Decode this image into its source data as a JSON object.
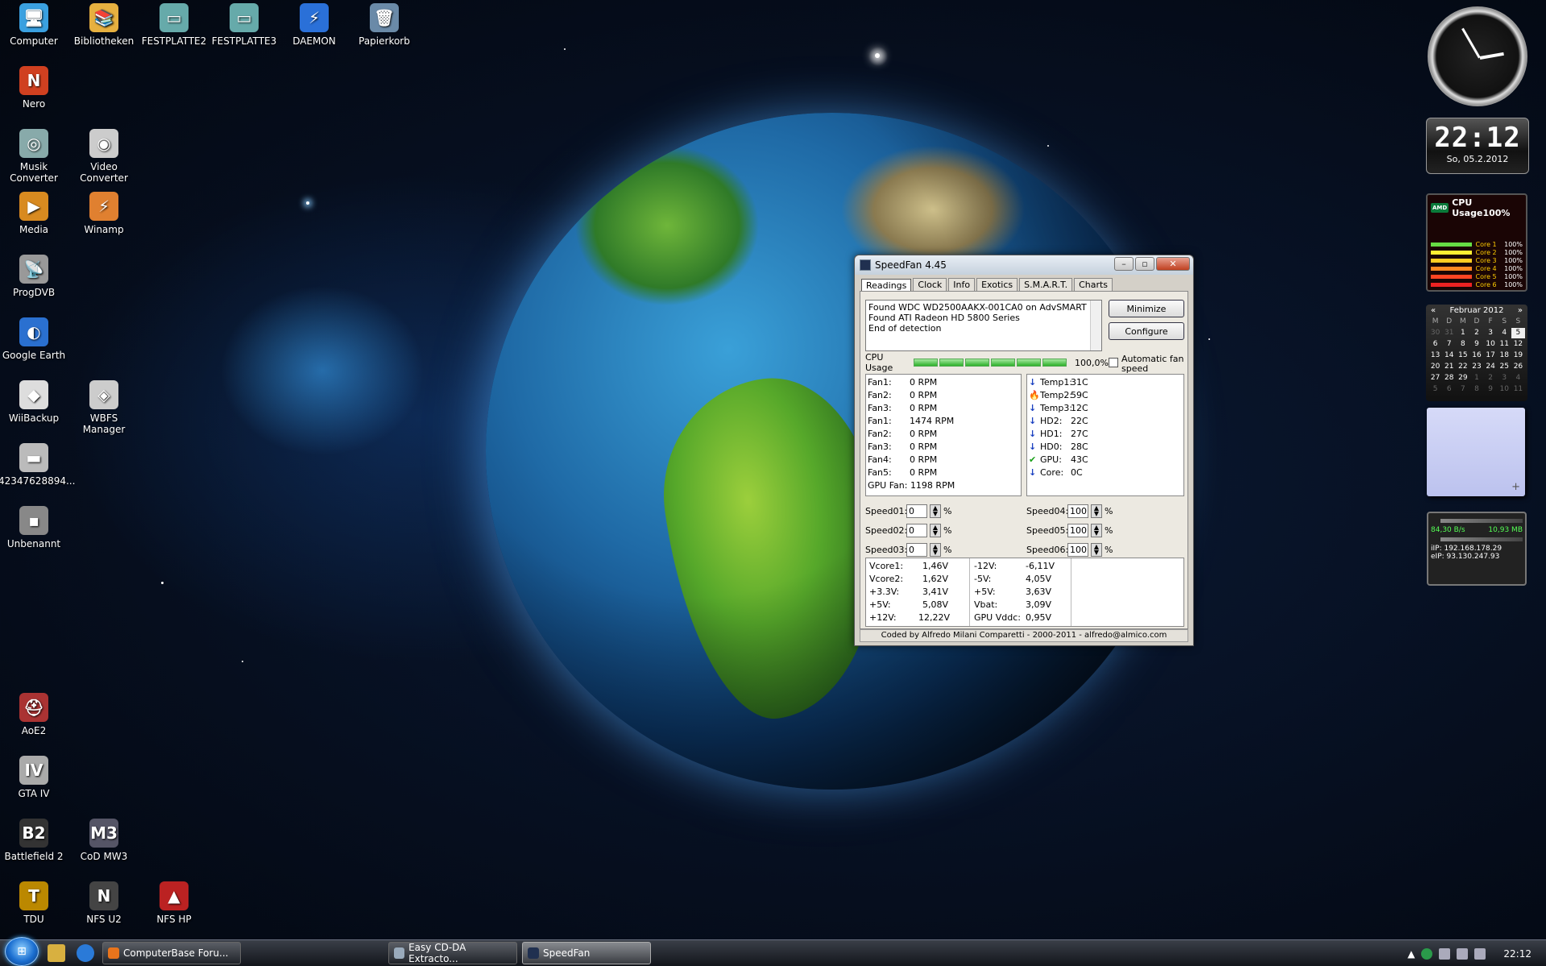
{
  "desktop_icons": [
    {
      "label": "Computer",
      "color": "#3aa0e0",
      "glyph": "🖥"
    },
    {
      "label": "Bibliotheken",
      "color": "#e6b040",
      "glyph": "📚"
    },
    {
      "label": "FESTPLATTE2",
      "color": "#6aa",
      "glyph": "▭"
    },
    {
      "label": "FESTPLATTE3",
      "color": "#6aa",
      "glyph": "▭"
    },
    {
      "label": "DAEMON",
      "color": "#2a70d8",
      "glyph": "⚡"
    },
    {
      "label": "Papierkorb",
      "color": "#6a8aa8",
      "glyph": "🗑"
    },
    {
      "label": "Nero",
      "color": "#d04020",
      "glyph": "N"
    },
    {
      "label": "Musik Converter",
      "color": "#8aa",
      "glyph": "◎"
    },
    {
      "label": "Video Converter",
      "color": "#ccc",
      "glyph": "◉"
    },
    {
      "label": "Media",
      "color": "#d88a20",
      "glyph": "▶"
    },
    {
      "label": "Winamp",
      "color": "#e08030",
      "glyph": "⚡"
    },
    {
      "label": "ProgDVB",
      "color": "#999",
      "glyph": "📡"
    },
    {
      "label": "Google Earth",
      "color": "#2a70d0",
      "glyph": "◐"
    },
    {
      "label": "WiiBackup",
      "color": "#ddd",
      "glyph": "◆"
    },
    {
      "label": "WBFS Manager",
      "color": "#ccc",
      "glyph": "◈"
    },
    {
      "label": "42347628894...",
      "color": "#bbb",
      "glyph": "▬"
    },
    {
      "label": "Unbenannt",
      "color": "#888",
      "glyph": "▪"
    },
    {
      "label": "AoE2",
      "color": "#a33",
      "glyph": "⛑"
    },
    {
      "label": "GTA IV",
      "color": "#aaa",
      "glyph": "IV"
    },
    {
      "label": "Battlefield 2",
      "color": "#333",
      "glyph": "B2"
    },
    {
      "label": "CoD MW3",
      "color": "#556",
      "glyph": "M3"
    },
    {
      "label": "TDU",
      "color": "#b80",
      "glyph": "T"
    },
    {
      "label": "NFS U2",
      "color": "#444",
      "glyph": "N"
    },
    {
      "label": "NFS HP",
      "color": "#b22",
      "glyph": "▲"
    }
  ],
  "gadgets": {
    "clock_time": "22:12",
    "clock_date": "So, 05.2.2012",
    "cpu": {
      "title": "CPU Usage100%",
      "cores": [
        {
          "label": "Core 1",
          "value": "100%",
          "color": "#66dd44"
        },
        {
          "label": "Core 2",
          "value": "100%",
          "color": "#ffee33"
        },
        {
          "label": "Core 3",
          "value": "100%",
          "color": "#ffcc22"
        },
        {
          "label": "Core 4",
          "value": "100%",
          "color": "#ff8822"
        },
        {
          "label": "Core 5",
          "value": "100%",
          "color": "#ff4422"
        },
        {
          "label": "Core 6",
          "value": "100%",
          "color": "#ee2222"
        }
      ]
    },
    "calendar": {
      "month": "Februar 2012",
      "weekdays": [
        "M",
        "D",
        "M",
        "D",
        "F",
        "S",
        "S"
      ],
      "days": [
        "30",
        "31",
        "1",
        "2",
        "3",
        "4",
        "5",
        "6",
        "7",
        "8",
        "9",
        "10",
        "11",
        "12",
        "13",
        "14",
        "15",
        "16",
        "17",
        "18",
        "19",
        "20",
        "21",
        "22",
        "23",
        "24",
        "25",
        "26",
        "27",
        "28",
        "29",
        "1",
        "2",
        "3",
        "4",
        "5",
        "6",
        "7",
        "8",
        "9",
        "10",
        "11"
      ],
      "today": "5"
    },
    "network": {
      "down_rate": "84,30 B/s",
      "down_total": "10,93 MB",
      "iip": "iIP: 192.168.178.29",
      "eip": "eIP: 93.130.247.93"
    }
  },
  "speedfan": {
    "title": "SpeedFan 4.45",
    "tabs": [
      "Readings",
      "Clock",
      "Info",
      "Exotics",
      "S.M.A.R.T.",
      "Charts"
    ],
    "log": [
      "Found WDC WD2500AAKX-001CA0 on AdvSMART",
      "Found ATI Radeon HD 5800 Series",
      "End of detection"
    ],
    "minimize_label": "Minimize",
    "configure_label": "Configure",
    "cpu_usage_label": "CPU Usage",
    "cpu_usage_value": "100,0%",
    "auto_fan_label": "Automatic fan speed",
    "fans": [
      {
        "name": "Fan1:",
        "value": "0 RPM"
      },
      {
        "name": "Fan2:",
        "value": "0 RPM"
      },
      {
        "name": "Fan3:",
        "value": "0 RPM"
      },
      {
        "name": "Fan1:",
        "value": "1474 RPM"
      },
      {
        "name": "Fan2:",
        "value": "0 RPM"
      },
      {
        "name": "Fan3:",
        "value": "0 RPM"
      },
      {
        "name": "Fan4:",
        "value": "0 RPM"
      },
      {
        "name": "Fan5:",
        "value": "0 RPM"
      }
    ],
    "gpu_fan": "GPU Fan: 1198 RPM",
    "temps": [
      {
        "name": "Temp1:",
        "value": "31C",
        "icon": "arrow-down-icon"
      },
      {
        "name": "Temp2:",
        "value": "59C",
        "icon": "flame-icon"
      },
      {
        "name": "Temp3:",
        "value": "12C",
        "icon": "arrow-down-icon"
      },
      {
        "name": "HD2:",
        "value": "22C",
        "icon": "arrow-down-icon"
      },
      {
        "name": "HD1:",
        "value": "27C",
        "icon": "arrow-down-icon"
      },
      {
        "name": "HD0:",
        "value": "28C",
        "icon": "arrow-down-icon"
      },
      {
        "name": "GPU:",
        "value": "43C",
        "icon": "check-icon"
      },
      {
        "name": "Core:",
        "value": "0C",
        "icon": "arrow-down-icon"
      }
    ],
    "speeds_left": [
      {
        "name": "Speed01:",
        "value": "0"
      },
      {
        "name": "Speed02:",
        "value": "0"
      },
      {
        "name": "Speed03:",
        "value": "0"
      }
    ],
    "speeds_right": [
      {
        "name": "Speed04:",
        "value": "100"
      },
      {
        "name": "Speed05:",
        "value": "100"
      },
      {
        "name": "Speed06:",
        "value": "100"
      }
    ],
    "percent": "%",
    "volts_left": [
      {
        "name": "Vcore1:",
        "value": "1,46V"
      },
      {
        "name": "Vcore2:",
        "value": "1,62V"
      },
      {
        "name": "+3.3V:",
        "value": "3,41V"
      },
      {
        "name": "+5V:",
        "value": "5,08V"
      },
      {
        "name": "+12V:",
        "value": "12,22V"
      }
    ],
    "volts_right": [
      {
        "name": "-12V:",
        "value": "-6,11V"
      },
      {
        "name": "-5V:",
        "value": "4,05V"
      },
      {
        "name": "+5V:",
        "value": "3,63V"
      },
      {
        "name": "Vbat:",
        "value": "3,09V"
      },
      {
        "name": "GPU Vddc:",
        "value": "0,95V"
      }
    ],
    "footer": "Coded by Alfredo Milani Comparetti - 2000-2011 - alfredo@almico.com"
  },
  "taskbar": {
    "tasks": [
      {
        "label": "ComputerBase Foru...",
        "color": "#e8741c"
      },
      {
        "label": "Easy CD-DA Extracto...",
        "color": "#9ab"
      },
      {
        "label": "SpeedFan",
        "color": "#203050"
      }
    ],
    "clock": "22:12"
  }
}
